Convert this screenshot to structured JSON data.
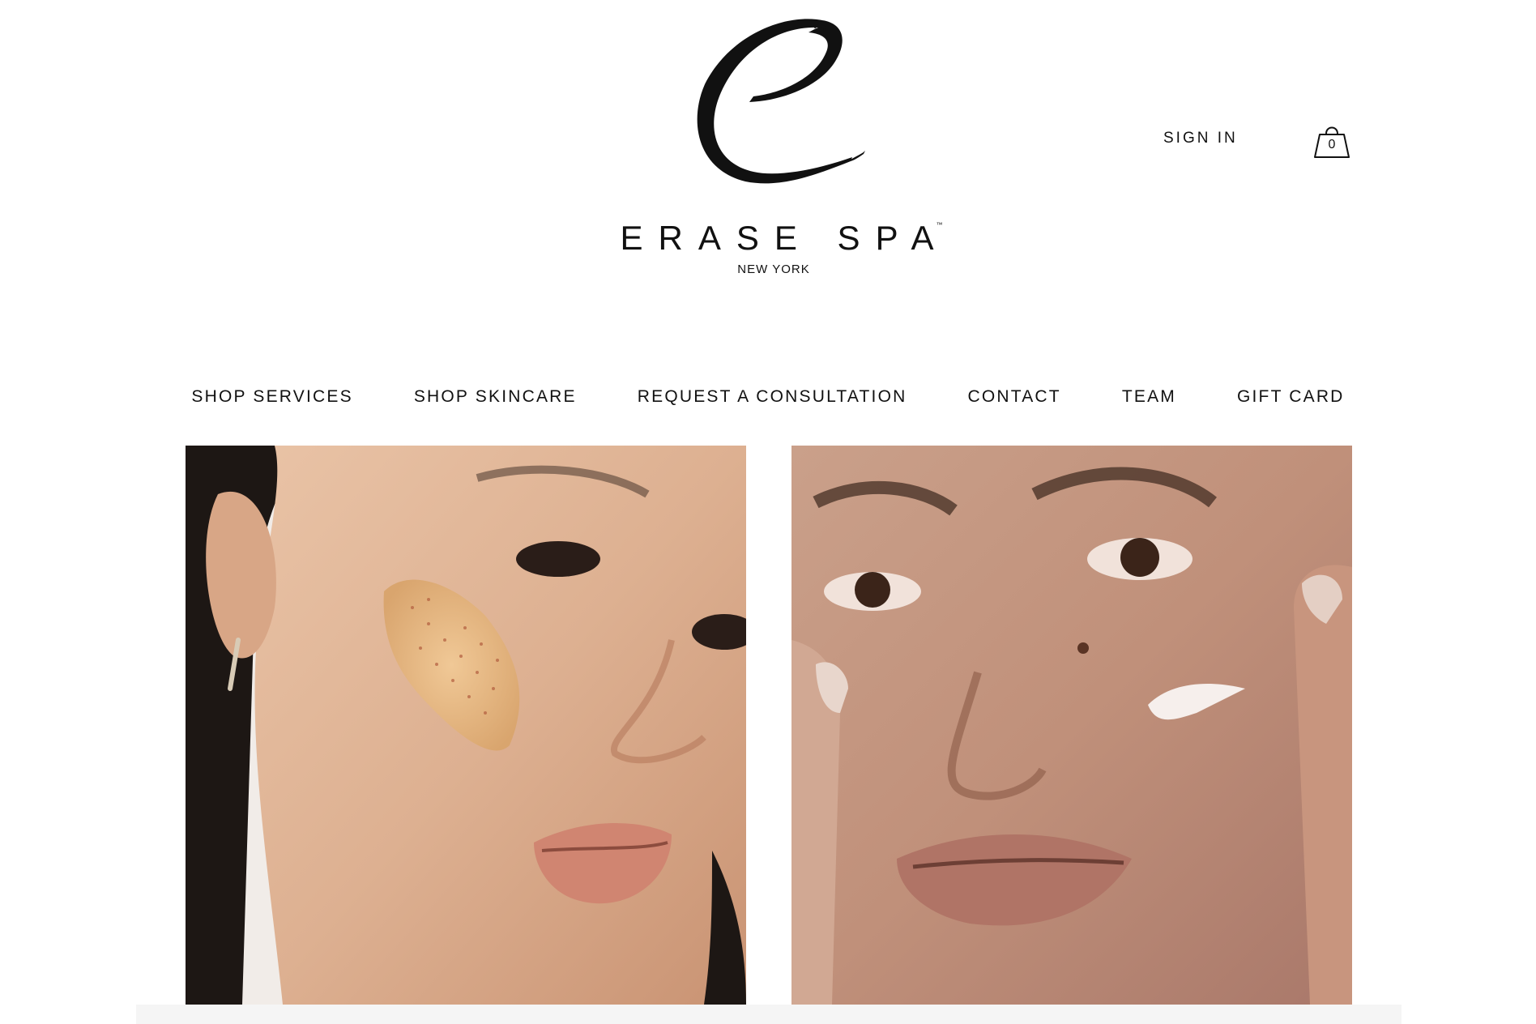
{
  "header": {
    "brand_name": "ERASE SPA",
    "brand_tm": "™",
    "brand_location": "NEW YORK",
    "sign_in_label": "SIGN IN",
    "cart_count": "0"
  },
  "nav": {
    "items": [
      {
        "label": "SHOP SERVICES"
      },
      {
        "label": "SHOP SKINCARE"
      },
      {
        "label": "REQUEST A CONSULTATION"
      },
      {
        "label": "CONTACT"
      },
      {
        "label": "TEAM"
      },
      {
        "label": "GIFT CARD"
      }
    ]
  },
  "hero": {
    "left_image": "woman-with-scrub-on-cheek",
    "right_image": "woman-applying-cream-to-cheek"
  },
  "icons": {
    "logo": "script-e-logo",
    "cart": "shopping-bag-icon"
  },
  "colors": {
    "text": "#111111",
    "background": "#ffffff"
  }
}
